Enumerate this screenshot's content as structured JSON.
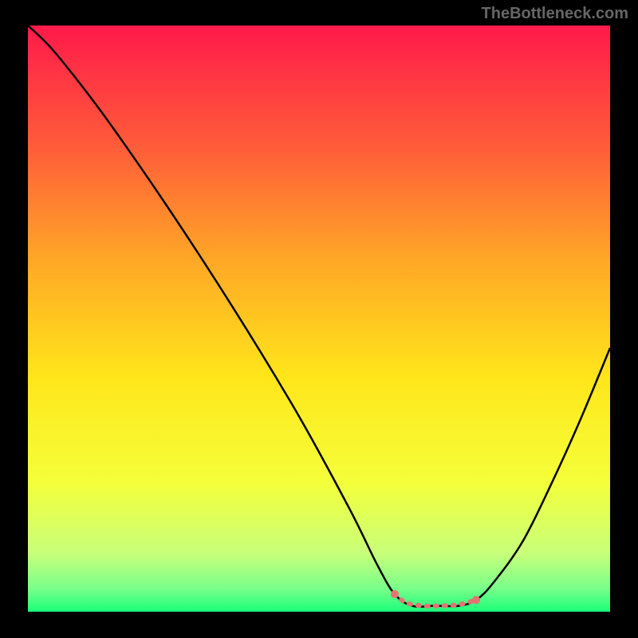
{
  "watermark": "TheBottleneck.com",
  "chart_data": {
    "type": "line",
    "title": "",
    "xlabel": "",
    "ylabel": "",
    "xlim": [
      0,
      100
    ],
    "ylim": [
      0,
      100
    ],
    "gradient_stops": [
      {
        "offset": 0,
        "color": "#ff1a4a"
      },
      {
        "offset": 20,
        "color": "#ff5a3a"
      },
      {
        "offset": 40,
        "color": "#ffa726"
      },
      {
        "offset": 60,
        "color": "#ffe61a"
      },
      {
        "offset": 78,
        "color": "#f4ff3a"
      },
      {
        "offset": 90,
        "color": "#c8ff7a"
      },
      {
        "offset": 96,
        "color": "#7aff8a"
      },
      {
        "offset": 100,
        "color": "#1aff7a"
      }
    ],
    "series": [
      {
        "name": "bottleneck-curve",
        "color": "#000000",
        "points": [
          {
            "x": 0,
            "y": 100
          },
          {
            "x": 5,
            "y": 95
          },
          {
            "x": 15,
            "y": 82
          },
          {
            "x": 30,
            "y": 60
          },
          {
            "x": 45,
            "y": 36
          },
          {
            "x": 55,
            "y": 18
          },
          {
            "x": 60,
            "y": 8
          },
          {
            "x": 63,
            "y": 3
          },
          {
            "x": 66,
            "y": 1
          },
          {
            "x": 70,
            "y": 1
          },
          {
            "x": 74,
            "y": 1
          },
          {
            "x": 77,
            "y": 2
          },
          {
            "x": 80,
            "y": 5
          },
          {
            "x": 85,
            "y": 12
          },
          {
            "x": 90,
            "y": 22
          },
          {
            "x": 95,
            "y": 33
          },
          {
            "x": 100,
            "y": 45
          }
        ]
      }
    ],
    "highlight_segment": {
      "color": "#e57373",
      "points": [
        {
          "x": 63,
          "y": 3
        },
        {
          "x": 65,
          "y": 1.5
        },
        {
          "x": 68,
          "y": 1
        },
        {
          "x": 71,
          "y": 1
        },
        {
          "x": 74,
          "y": 1.2
        },
        {
          "x": 77,
          "y": 2
        }
      ],
      "end_dots": [
        {
          "x": 63,
          "y": 3
        },
        {
          "x": 77,
          "y": 2
        }
      ]
    }
  }
}
